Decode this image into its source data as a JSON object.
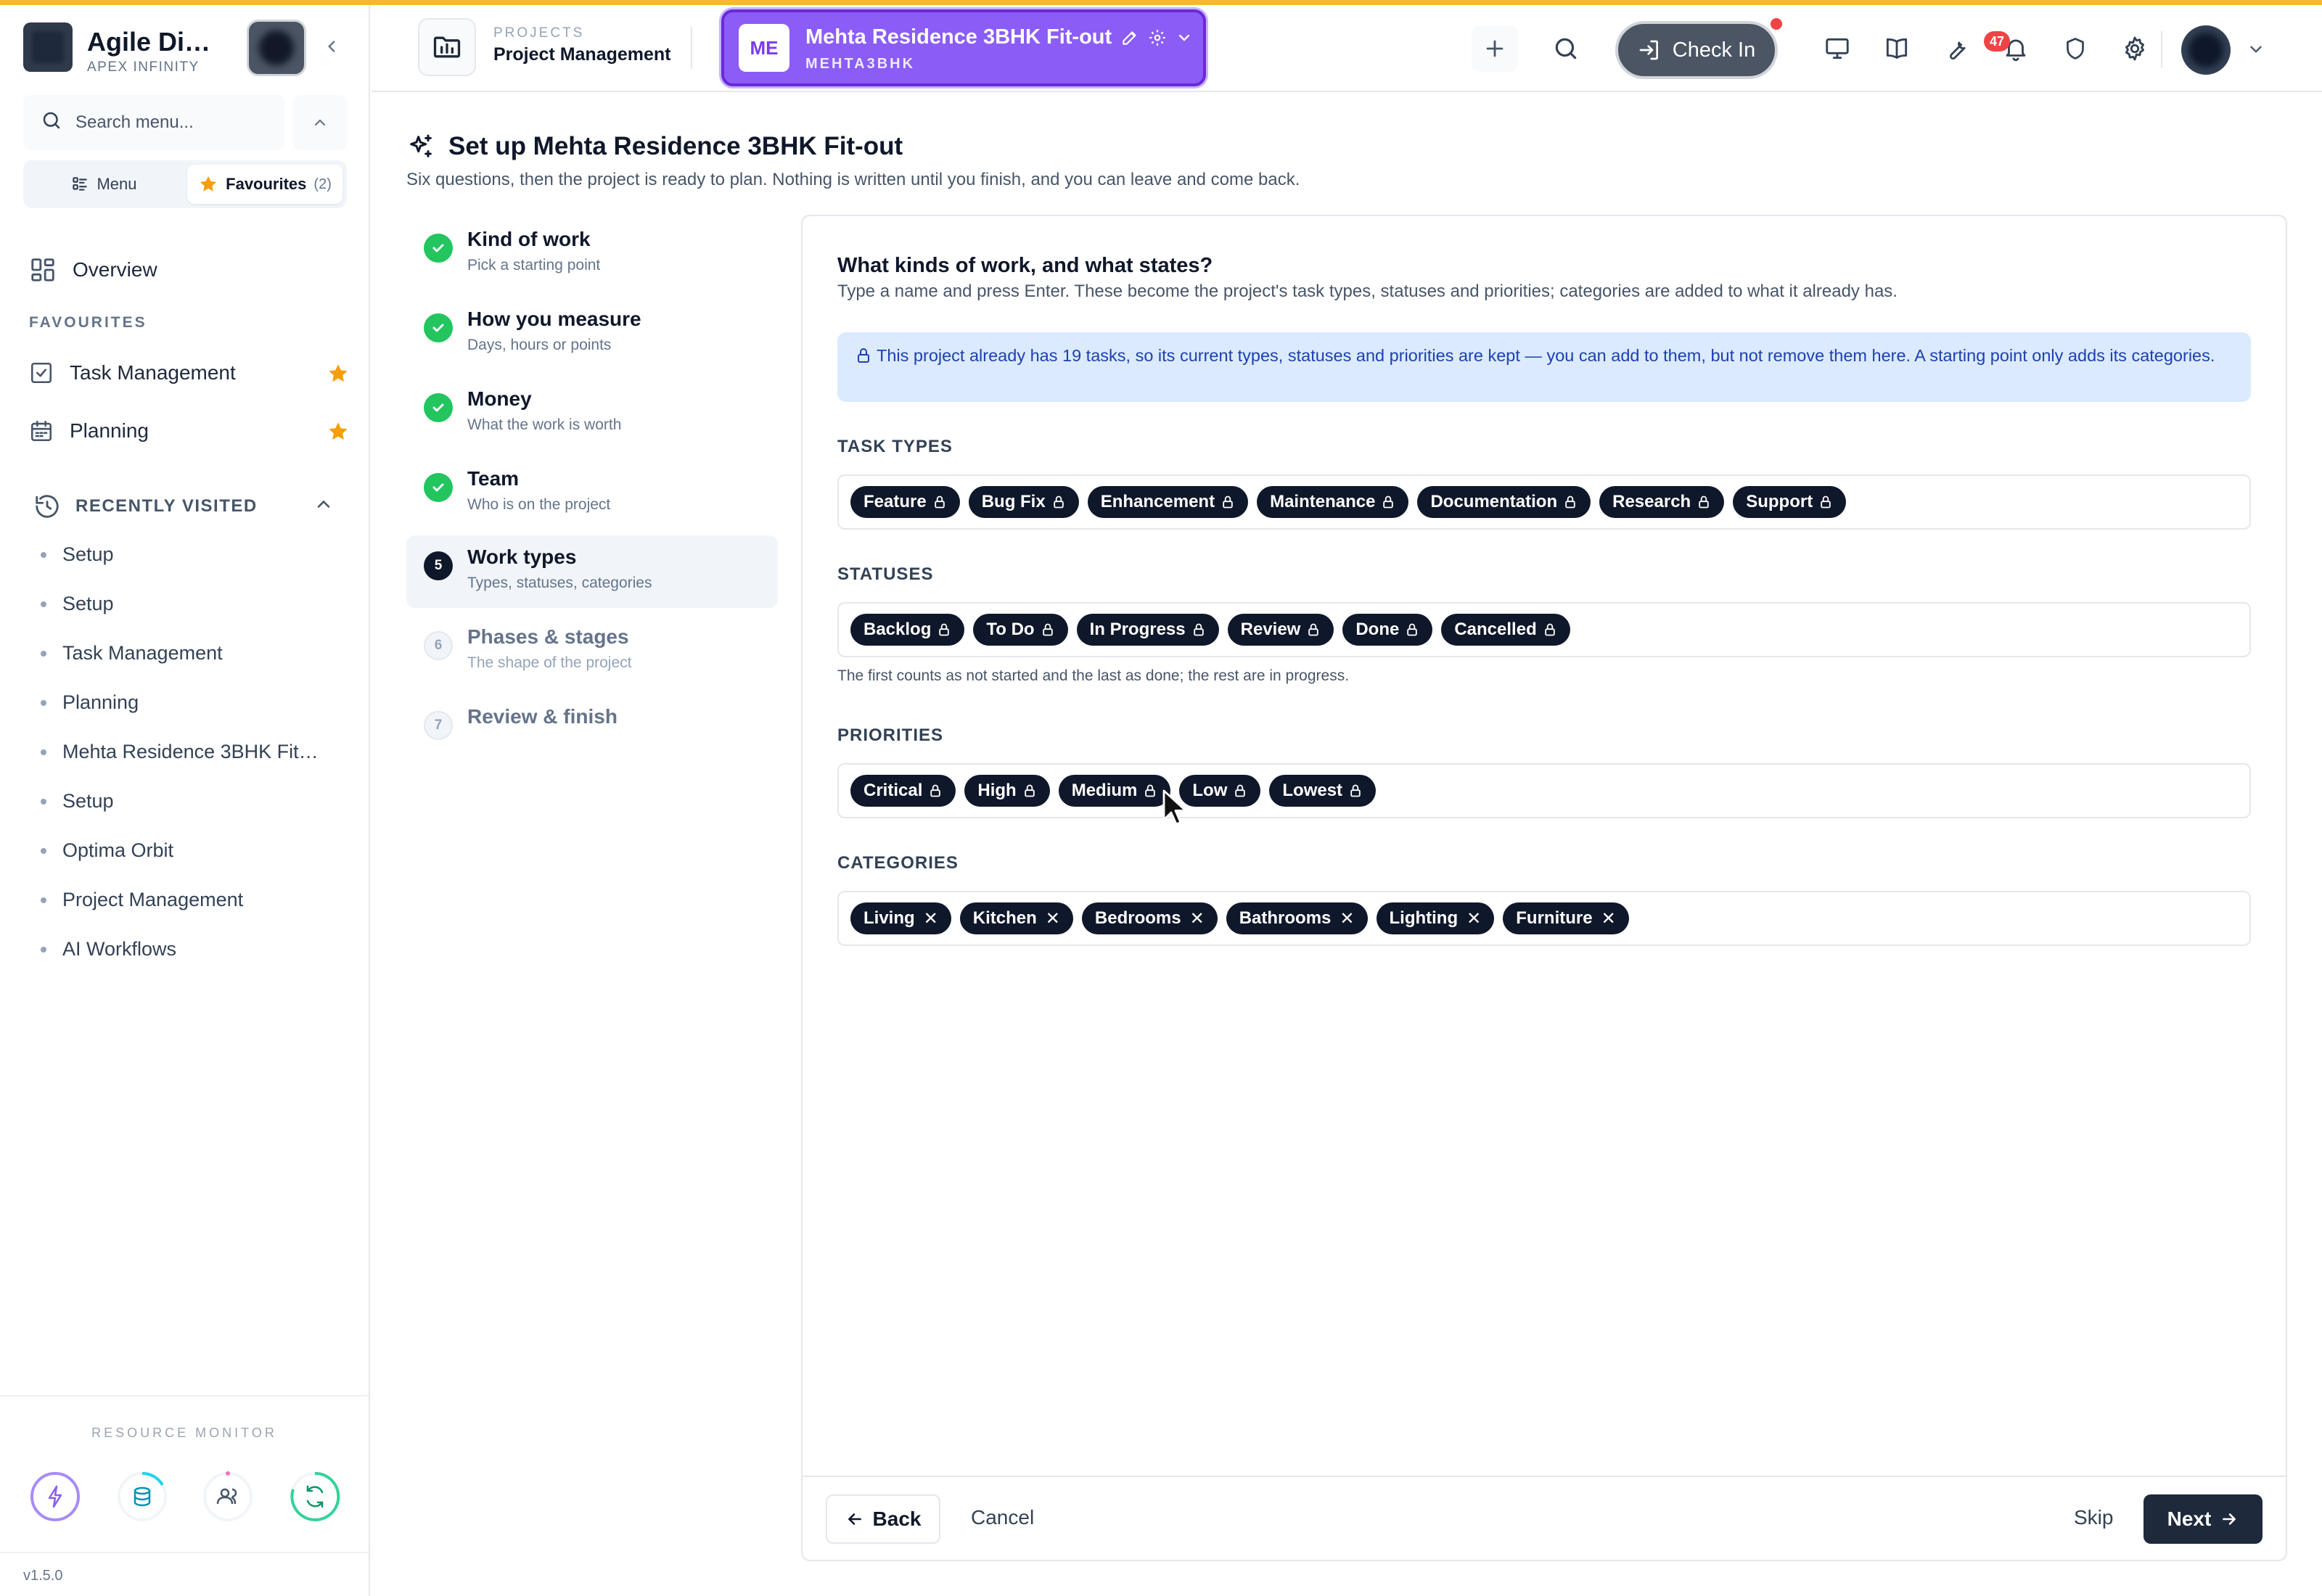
{
  "colors": {
    "accent_purple": "#8b5cf6",
    "top_line": "#f5b82e",
    "done_green": "#22c55e",
    "chip_dark": "#0f172a",
    "info_bg": "#dbeafe",
    "info_text": "#1e40af",
    "star": "#f59e0b",
    "badge_red": "#ef4444"
  },
  "sidebar": {
    "brand_name": "Agile Di…",
    "brand_sub": "APEX INFINITY",
    "search_placeholder": "Search menu...",
    "tab_menu": "Menu",
    "tab_favourites": "Favourites",
    "favourites_count": "(2)",
    "overview": "Overview",
    "favourites_label": "FAVOURITES",
    "favourites": [
      {
        "label": "Task Management",
        "icon": "checkbox-icon"
      },
      {
        "label": "Planning",
        "icon": "calendar-icon"
      }
    ],
    "recently_visited_label": "RECENTLY VISITED",
    "recent": [
      "Setup",
      "Setup",
      "Task Management",
      "Planning",
      "Mehta Residence 3BHK Fit…",
      "Setup",
      "Optima Orbit",
      "Project Management",
      "AI Workflows"
    ],
    "resource_monitor_label": "RESOURCE MONITOR",
    "version": "v1.5.0"
  },
  "header": {
    "crumb_small": "PROJECTS",
    "crumb_big": "Project Management",
    "project_badge": "ME",
    "project_name": "Mehta Residence 3BHK Fit-out",
    "project_code": "MEHTA3BHK",
    "check_in": "Check In",
    "notification_count": "47"
  },
  "page": {
    "title": "Set up Mehta Residence 3BHK Fit-out",
    "subtitle": "Six questions, then the project is ready to plan. Nothing is written until you finish, and you can leave and come back."
  },
  "steps": [
    {
      "num": "1",
      "title": "Kind of work",
      "sub": "Pick a starting point",
      "state": "done"
    },
    {
      "num": "2",
      "title": "How you measure",
      "sub": "Days, hours or points",
      "state": "done"
    },
    {
      "num": "3",
      "title": "Money",
      "sub": "What the work is worth",
      "state": "done"
    },
    {
      "num": "4",
      "title": "Team",
      "sub": "Who is on the project",
      "state": "done"
    },
    {
      "num": "5",
      "title": "Work types",
      "sub": "Types, statuses, categories",
      "state": "current"
    },
    {
      "num": "6",
      "title": "Phases & stages",
      "sub": "The shape of the project",
      "state": "todo"
    },
    {
      "num": "7",
      "title": "Review & finish",
      "sub": "",
      "state": "todo"
    }
  ],
  "card": {
    "question": "What kinds of work, and what states?",
    "question_sub": "Type a name and press Enter. These become the project's task types, statuses and priorities; categories are added to what it already has.",
    "info": "This project already has 19 tasks, so its current types, statuses and priorities are kept — you can add to them, but not remove them here. A starting point only adds its categories.",
    "task_types_label": "TASK TYPES",
    "task_types": [
      "Feature",
      "Bug Fix",
      "Enhancement",
      "Maintenance",
      "Documentation",
      "Research",
      "Support"
    ],
    "statuses_label": "STATUSES",
    "statuses": [
      "Backlog",
      "To Do",
      "In Progress",
      "Review",
      "Done",
      "Cancelled"
    ],
    "statuses_hint": "The first counts as not started and the last as done; the rest are in progress.",
    "priorities_label": "PRIORITIES",
    "priorities": [
      "Critical",
      "High",
      "Medium",
      "Low",
      "Lowest"
    ],
    "categories_label": "CATEGORIES",
    "categories": [
      "Living",
      "Kitchen",
      "Bedrooms",
      "Bathrooms",
      "Lighting",
      "Furniture"
    ],
    "back": "Back",
    "cancel": "Cancel",
    "skip": "Skip",
    "next": "Next"
  }
}
